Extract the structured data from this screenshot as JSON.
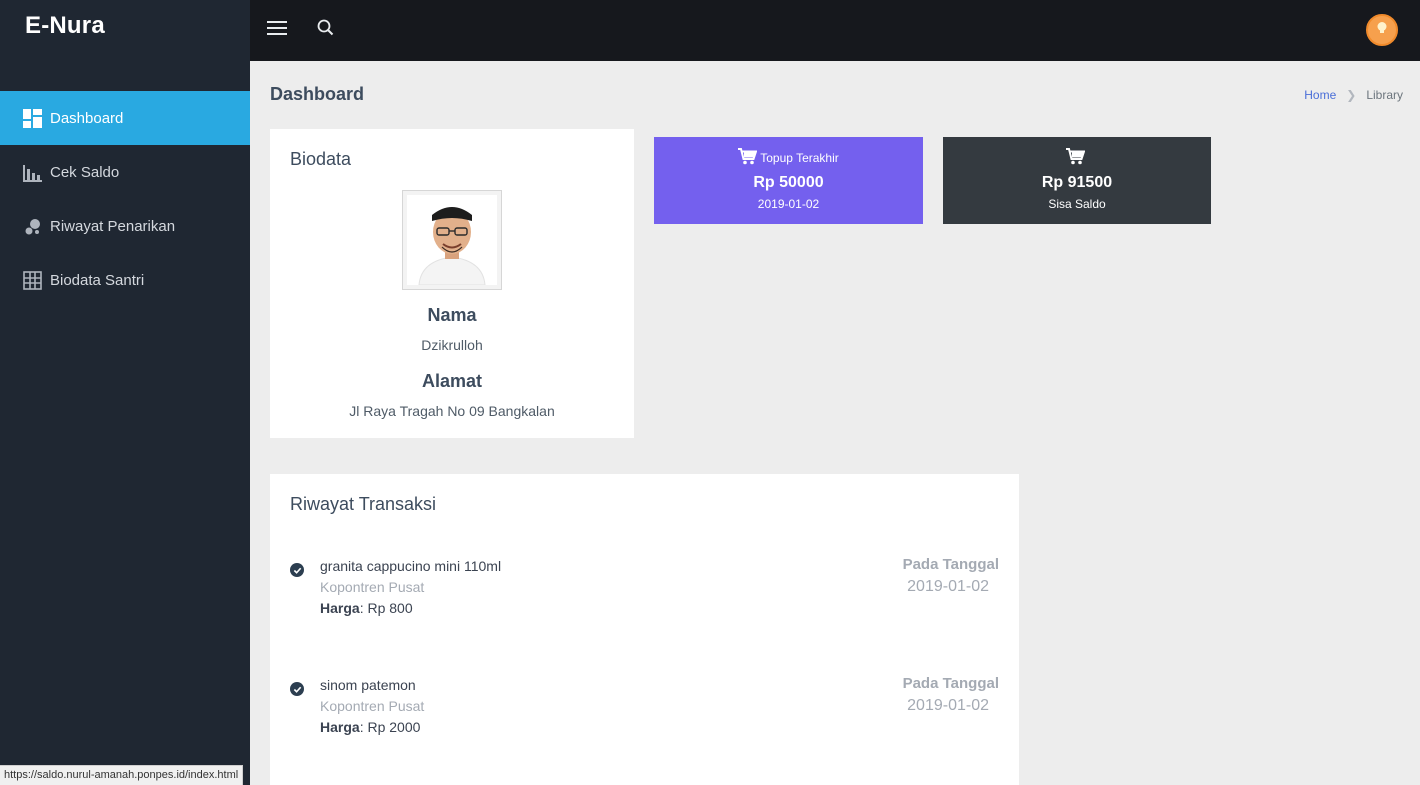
{
  "app": {
    "brand": "E-Nura"
  },
  "sidebar": {
    "items": [
      {
        "label": "Dashboard",
        "icon": "dashboard-icon",
        "active": true
      },
      {
        "label": "Cek Saldo",
        "icon": "bar-chart-icon",
        "active": false
      },
      {
        "label": "Riwayat Penarikan",
        "icon": "bubbles-icon",
        "active": false
      },
      {
        "label": "Biodata Santri",
        "icon": "grid-icon",
        "active": false
      }
    ]
  },
  "topbar": {
    "menu_icon": "hamburger-icon",
    "search_icon": "search-icon",
    "user_icon": "lightbulb-icon"
  },
  "page": {
    "title": "Dashboard"
  },
  "breadcrumb": {
    "home": "Home",
    "current": "Library"
  },
  "biodata": {
    "title": "Biodata",
    "name_label": "Nama",
    "name": "Dzikrulloh",
    "address_label": "Alamat",
    "address": "Jl Raya Tragah No 09 Bangkalan"
  },
  "stats": {
    "topup": {
      "label": "Topup Terakhir",
      "value": "Rp 50000",
      "date": "2019-01-02",
      "icon": "cart-icon",
      "color": "#7460ee"
    },
    "saldo": {
      "value": "Rp 91500",
      "label": "Sisa Saldo",
      "icon": "cart-icon",
      "color": "#343a40"
    }
  },
  "transactions": {
    "title": "Riwayat Transaksi",
    "price_label": "Harga",
    "date_label": "Pada Tanggal",
    "items": [
      {
        "name": "granita cappucino mini 110ml",
        "shop": "Kopontren Pusat",
        "price": ": Rp 800",
        "date": "2019-01-02"
      },
      {
        "name": "sinom patemon",
        "shop": "Kopontren Pusat",
        "price": ": Rp 2000",
        "date": "2019-01-02"
      }
    ]
  },
  "status_bar": {
    "url": "https://saldo.nurul-amanah.ponpes.id/index.html"
  },
  "colors": {
    "sidebar": "#1f2732",
    "active": "#29a9e1",
    "topbar": "#16181d",
    "accent_purple": "#7460ee"
  }
}
